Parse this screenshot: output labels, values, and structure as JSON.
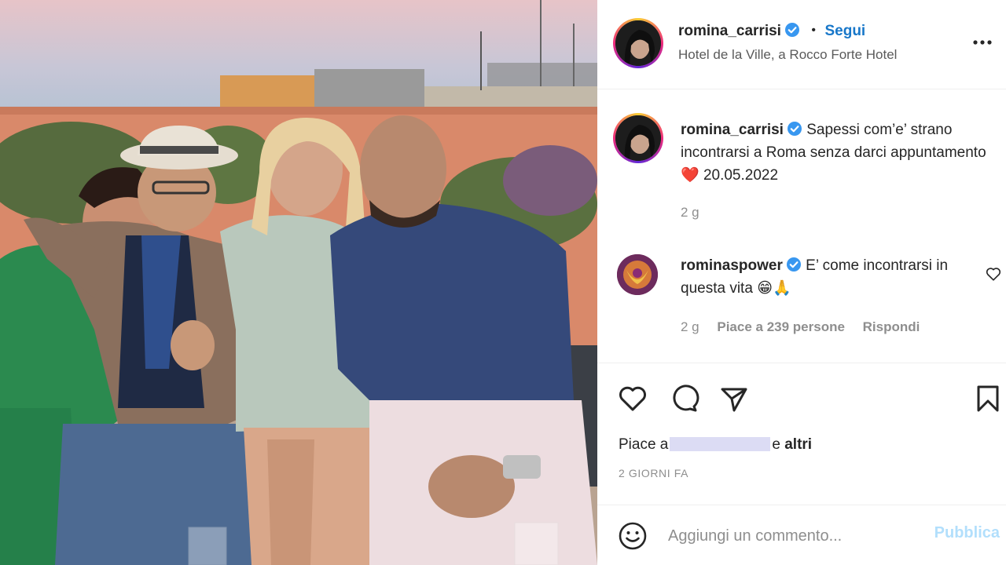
{
  "post": {
    "author": "romina_carrisi",
    "follow_label": "Segui",
    "separator": "•",
    "location": "Hotel de la Ville, a Rocco Forte Hotel",
    "more_icon": "more-horizontal-icon"
  },
  "caption": {
    "author": "romina_carrisi",
    "text": "Sapessi com’e’ strano incontrarsi a Roma senza darci appuntamento",
    "emoji": "❤️",
    "date": "20.05.2022",
    "time": "2 g"
  },
  "comment": {
    "author": "rominaspower",
    "text": "E’ come incontrarsi in questa vita",
    "emojis": "😁🙏",
    "time": "2 g",
    "likes": "Piace a 239 persone",
    "reply": "Rispondi"
  },
  "actions": {
    "icons": [
      "heart-icon",
      "comment-icon",
      "share-icon",
      "bookmark-icon"
    ]
  },
  "likes": {
    "prefix": "Piace a",
    "connector": "e",
    "others": "altri"
  },
  "timestamp": "2 GIORNI FA",
  "add_comment": {
    "placeholder": "Aggiungi un commento...",
    "publish": "Pubblica"
  },
  "colors": {
    "link": "#1877c9",
    "verified": "#3897f0",
    "muted": "#8e8e8e",
    "publish_disabled": "#b2dffc"
  }
}
